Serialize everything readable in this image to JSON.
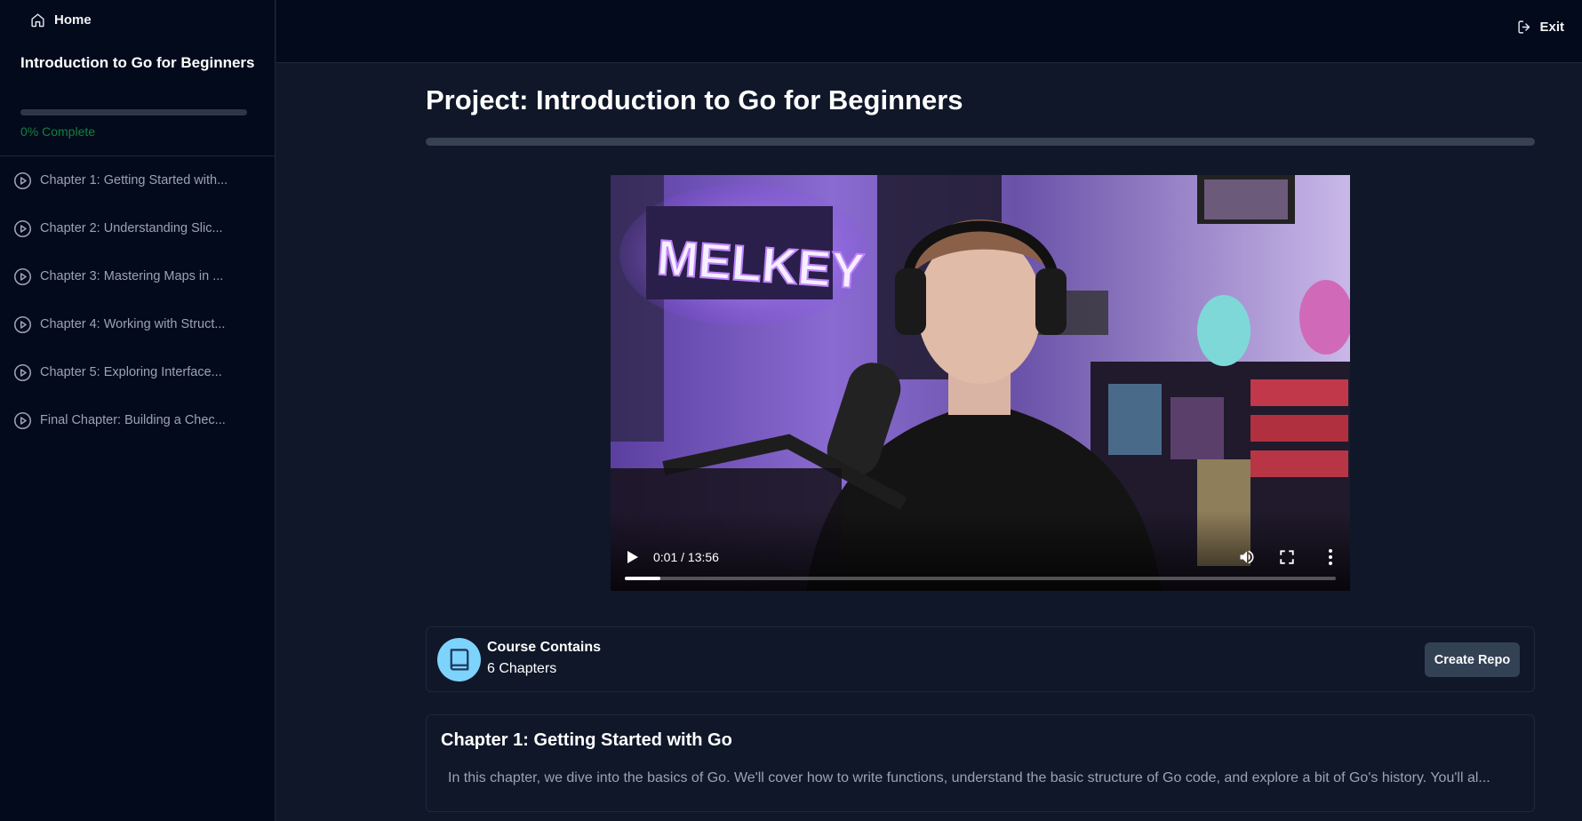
{
  "sidebar": {
    "home_label": "Home",
    "course_title": "Introduction to Go for Beginners",
    "progress_percent": 0,
    "progress_text": "0% Complete",
    "chapters": [
      {
        "label": "Chapter 1: Getting Started with..."
      },
      {
        "label": "Chapter 2: Understanding Slic..."
      },
      {
        "label": "Chapter 3: Mastering Maps in ..."
      },
      {
        "label": "Chapter 4: Working with Struct..."
      },
      {
        "label": "Chapter 5: Exploring Interface..."
      },
      {
        "label": "Final Chapter: Building a Chec..."
      }
    ]
  },
  "topbar": {
    "exit_label": "Exit"
  },
  "main": {
    "page_title": "Project: Introduction to Go for Beginners",
    "video": {
      "time_text": "0:01 / 13:56",
      "current_seconds": 1,
      "duration_seconds": 836,
      "neon_sign_text": "MELKEY"
    },
    "info_card": {
      "title": "Course Contains",
      "subtitle": "6 Chapters",
      "create_repo_label": "Create Repo"
    },
    "chapter_card": {
      "title": "Chapter 1: Getting Started with Go",
      "description": "In this chapter, we dive into the basics of Go. We'll cover how to write functions, understand the basic structure of Go code, and explore a bit of Go's history. You'll al..."
    }
  },
  "colors": {
    "sidebar_bg": "#030a1c",
    "main_bg": "#0f1729",
    "progress_green": "#15803d",
    "button_bg": "#334155",
    "book_icon_bg": "#7dd3fc"
  }
}
